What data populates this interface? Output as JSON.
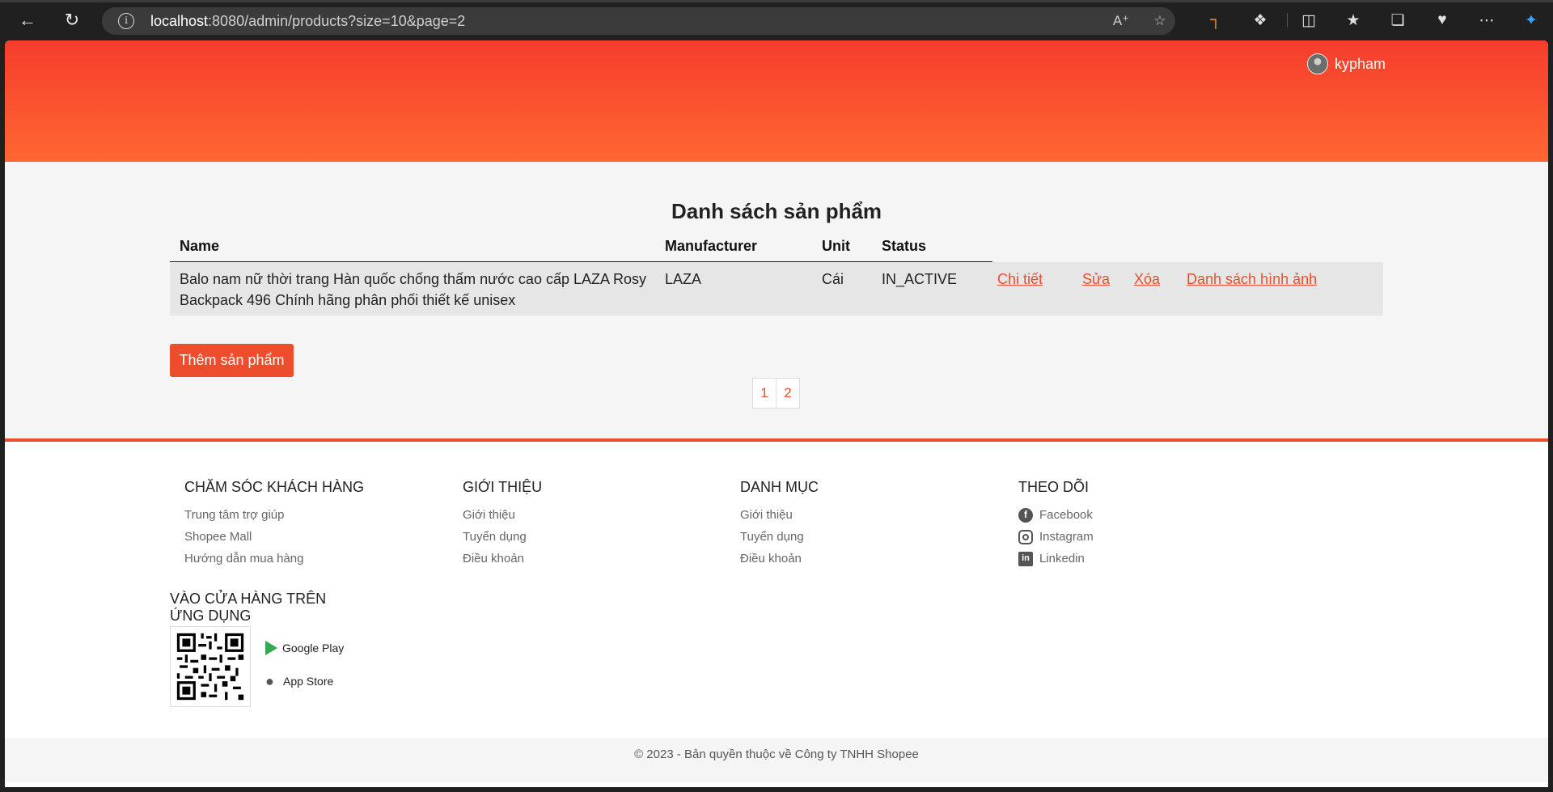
{
  "browser": {
    "url_host": "localhost",
    "url_rest": ":8080/admin/products?size=10&page=2"
  },
  "header": {
    "username": "kypham"
  },
  "main": {
    "title": "Danh sách sản phẩm",
    "columns": [
      "Name",
      "Manufacturer",
      "Unit",
      "Status"
    ],
    "rows": [
      {
        "name_line1": "Balo nam nữ thời trang Hàn quốc chống thấm nước cao cấp LAZA Rosy",
        "name_line2": "Backpack 496 Chính hãng phân phối thiết kế unisex",
        "manufacturer": "LAZA",
        "unit": "Cái",
        "status": "IN_ACTIVE",
        "actions": [
          "Chi tiết",
          "Sửa",
          "Xóa",
          "Danh sách hình ảnh"
        ]
      }
    ],
    "add_button": "Thêm sản phẩm",
    "pages": [
      "1",
      "2"
    ]
  },
  "footer": {
    "customer_care": {
      "title": "CHĂM SÓC KHÁCH HÀNG",
      "links": [
        "Trung tâm trợ giúp",
        "Shopee Mall",
        "Hướng dẫn mua hàng"
      ]
    },
    "about": {
      "title": "GIỚI THIỆU",
      "links": [
        "Giới thiệu",
        "Tuyển dụng",
        "Điều khoản"
      ]
    },
    "categories": {
      "title": "DANH MỤC",
      "links": [
        "Giới thiệu",
        "Tuyển dụng",
        "Điều khoản"
      ]
    },
    "follow": {
      "title": "THEO DÕI",
      "links": [
        "Facebook",
        "Instagram",
        "Linkedin"
      ]
    },
    "app": {
      "title": "VÀO CỬA HÀNG TRÊN ỨNG DỤNG",
      "google_play": "Google Play",
      "app_store": "App Store"
    },
    "copyright": "© 2023 - Bản quyền thuộc về Công ty TNHH Shopee"
  }
}
